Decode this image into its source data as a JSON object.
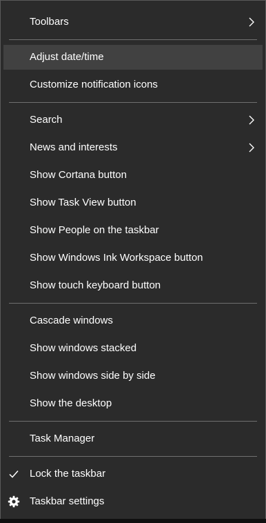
{
  "menu": {
    "toolbars": "Toolbars",
    "adjust_date_time": "Adjust date/time",
    "customize_notification_icons": "Customize notification icons",
    "search": "Search",
    "news_and_interests": "News and interests",
    "show_cortana_button": "Show Cortana button",
    "show_task_view_button": "Show Task View button",
    "show_people": "Show People on the taskbar",
    "show_ink_workspace": "Show Windows Ink Workspace button",
    "show_touch_keyboard": "Show touch keyboard button",
    "cascade_windows": "Cascade windows",
    "show_windows_stacked": "Show windows stacked",
    "show_windows_side_by_side": "Show windows side by side",
    "show_desktop": "Show the desktop",
    "task_manager": "Task Manager",
    "lock_taskbar": "Lock the taskbar",
    "taskbar_settings": "Taskbar settings"
  },
  "icons": {
    "submenu": "chevron-right-icon",
    "checked": "checkmark-icon",
    "settings": "gear-icon"
  },
  "colors": {
    "background": "#2b2b2b",
    "hover": "#414141",
    "text": "#ffffff",
    "separator": "#707070"
  }
}
